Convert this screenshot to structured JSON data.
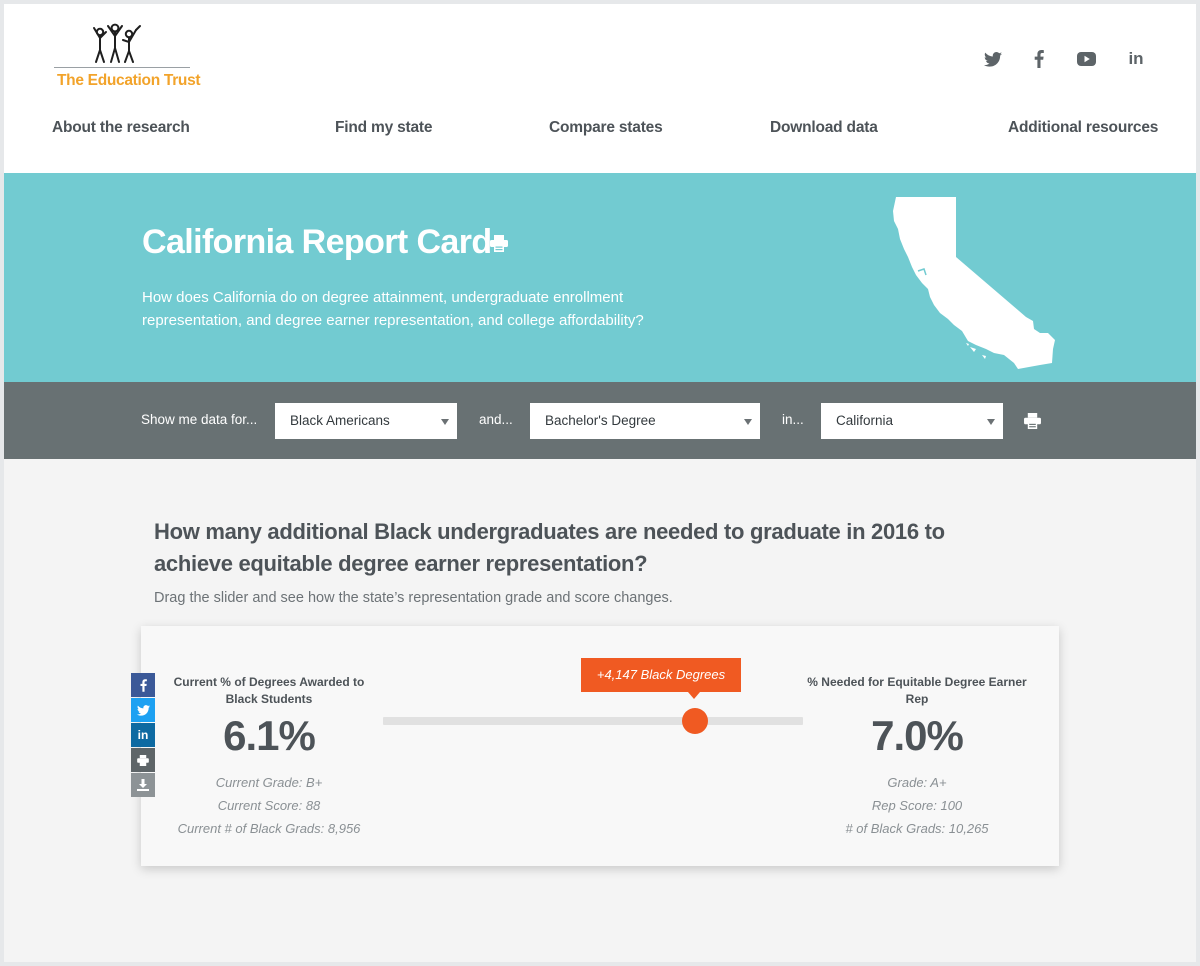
{
  "brand": {
    "name": "The Education Trust",
    "accent": "#f2a32a"
  },
  "social": [
    {
      "icon": "twitter-icon"
    },
    {
      "icon": "facebook-icon"
    },
    {
      "icon": "youtube-icon"
    },
    {
      "icon": "linkedin-icon",
      "text": "in"
    }
  ],
  "nav": [
    {
      "label": "About the research"
    },
    {
      "label": "Find my state"
    },
    {
      "label": "Compare states"
    },
    {
      "label": "Download data"
    },
    {
      "label": "Additional resources"
    }
  ],
  "hero": {
    "title": "California Report Card",
    "description": "How does California do on degree attainment, undergraduate enrollment representation, and degree earner representation, and college affordability?",
    "color": "#72cbd1"
  },
  "filters": {
    "label_show": "Show me data for...",
    "label_and": "and...",
    "label_in": "in...",
    "group": "Black Americans",
    "degree": "Bachelor's Degree",
    "state": "California"
  },
  "question": {
    "title": "How many additional Black undergraduates are needed to graduate in 2016 to achieve equitable degree earner representation?",
    "instruction": "Drag the slider and see how the state’s representation grade and score changes."
  },
  "card": {
    "left": {
      "label": "Current % of Degrees Awarded to Black Students",
      "value": "6.1%",
      "grade": "Current Grade: B+",
      "score": "Current Score: 88",
      "grads": "Current # of Black Grads: 8,956"
    },
    "slider": {
      "tooltip": "+4,147 Black Degrees",
      "position": 0.74,
      "color": "#f05a22"
    },
    "right": {
      "label": "% Needed for Equitable Degree Earner Rep",
      "value": "7.0%",
      "grade": "Grade: A+",
      "score": "Rep Score: 100",
      "grads": "# of Black Grads: 10,265"
    }
  },
  "share_buttons": [
    {
      "icon": "facebook-icon",
      "color": "#3b5998"
    },
    {
      "icon": "twitter-icon",
      "color": "#1da1f2"
    },
    {
      "icon": "linkedin-icon",
      "color": "#0e6aa2",
      "text": "in"
    },
    {
      "icon": "print-icon",
      "color": "#5e6568"
    },
    {
      "icon": "download-icon",
      "color": "#8d9396"
    }
  ]
}
